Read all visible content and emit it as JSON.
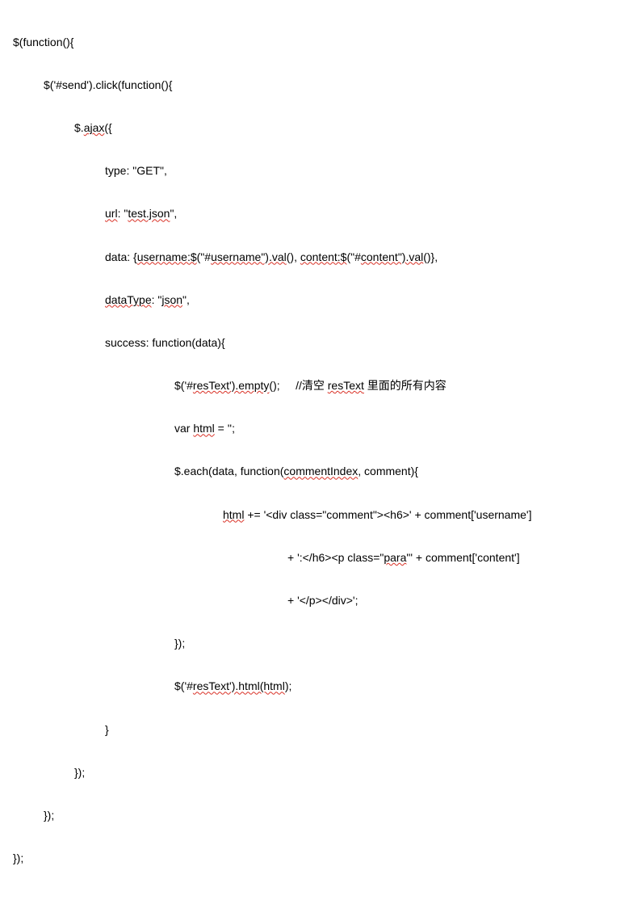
{
  "code": {
    "l1_a": "$(function(){",
    "l2_a": "$('#send').click(function(){",
    "l3_a": "$.",
    "l3_b": "ajax",
    "l3_c": "({",
    "l4_a": "type: \"GET\",",
    "l5_a": "url",
    "l5_b": ": \"",
    "l5_c": "test.json",
    "l5_d": "\",",
    "l6_a": "data: {",
    "l6_b": "username:$",
    "l6_c": "(\"#",
    "l6_d": "username\").val",
    "l6_e": "(), ",
    "l6_f": "content:$",
    "l6_g": "(\"#",
    "l6_h": "content\").val",
    "l6_i": "()},",
    "l7_a": "dataType",
    "l7_b": ": \"",
    "l7_c": "json",
    "l7_d": "\",",
    "l8_a": "success: function(data){",
    "l9_a": "$('#",
    "l9_b": "resText').empty",
    "l9_c": "();",
    "l9_gap": "     ",
    "l9_d": "//清空 ",
    "l9_e": "resText",
    "l9_f": " 里面的所有内容",
    "l10_a": "var ",
    "l10_b": "html",
    "l10_c": " = '';",
    "l11_a": "$.each(data, function(",
    "l11_b": "commentIndex",
    "l11_c": ", comment){",
    "l12_a": "html",
    "l12_b": " += '<div class=\"comment\"><h6>' + comment['username']",
    "l13_a": "+ ':</h6><p class=\"",
    "l13_b": "para",
    "l13_c": "\"' + comment['content']",
    "l14_a": "+ '</p></div>';",
    "l15_a": "});",
    "l16_a": "$('#",
    "l16_b": "resText').html(html",
    "l16_c": ");",
    "l17_a": "}",
    "l18_a": "});",
    "l19_a": "});",
    "l20_a": "});"
  }
}
